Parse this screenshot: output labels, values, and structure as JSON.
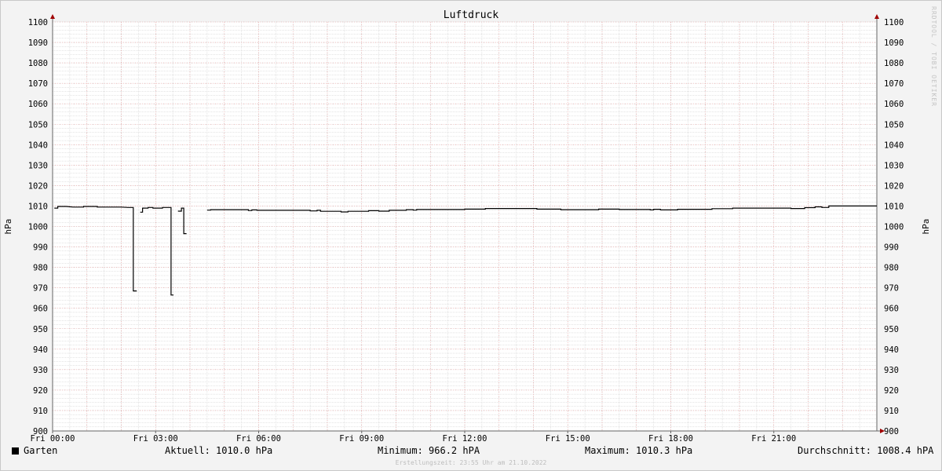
{
  "watermark": "RRDTOOL / TOBI OETIKER",
  "legend": {
    "series_label": "Garten",
    "current": "Aktuell: 1010.0 hPa",
    "minimum": "Minimum: 966.2 hPA",
    "maximum": "Maximum: 1010.3 hPa",
    "average": "Durchschnitt: 1008.4 hPA"
  },
  "footer": "Erstellungszeit: 23:55 Uhr am 21.10.2022",
  "colors": {
    "line": "#000000",
    "major_grid": "#f0a0a0",
    "minor_grid": "#c8c8c8",
    "background": "#ffffff",
    "canvas": "#f3f3f3"
  },
  "chart_data": {
    "type": "line",
    "title": "Luftdruck",
    "ylabel": "hPa",
    "ylabel_right": "hPa",
    "ylim": [
      900,
      1100
    ],
    "xlim": [
      0,
      24
    ],
    "yticks": [
      900,
      910,
      920,
      930,
      940,
      950,
      960,
      970,
      980,
      990,
      1000,
      1010,
      1020,
      1030,
      1040,
      1050,
      1060,
      1070,
      1080,
      1090,
      1100
    ],
    "xticks": [
      {
        "t": 0,
        "label": "Fri 00:00"
      },
      {
        "t": 3,
        "label": "Fri 03:00"
      },
      {
        "t": 6,
        "label": "Fri 06:00"
      },
      {
        "t": 9,
        "label": "Fri 09:00"
      },
      {
        "t": 12,
        "label": "Fri 12:00"
      },
      {
        "t": 15,
        "label": "Fri 15:00"
      },
      {
        "t": 18,
        "label": "Fri 18:00"
      },
      {
        "t": 21,
        "label": "Fri 21:00"
      }
    ],
    "grid": true,
    "legend": "bottom",
    "series": [
      {
        "name": "Garten",
        "segments": [
          [
            [
              0.05,
              1009.0
            ],
            [
              0.15,
              1009.0
            ],
            [
              0.15,
              1009.8
            ],
            [
              0.4,
              1009.8
            ],
            [
              0.6,
              1009.5
            ],
            [
              0.9,
              1009.5
            ],
            [
              0.9,
              1009.8
            ],
            [
              1.3,
              1009.8
            ],
            [
              1.3,
              1009.5
            ],
            [
              2.0,
              1009.5
            ],
            [
              2.2,
              1009.3
            ],
            [
              2.35,
              1009.3
            ],
            [
              2.35,
              968.5
            ],
            [
              2.45,
              968.5
            ]
          ],
          [
            [
              2.55,
              1007.0
            ],
            [
              2.62,
              1007.0
            ],
            [
              2.62,
              1009.0
            ],
            [
              2.78,
              1009.0
            ],
            [
              2.78,
              1009.3
            ],
            [
              2.92,
              1009.3
            ],
            [
              2.92,
              1009.0
            ],
            [
              3.2,
              1009.0
            ],
            [
              3.2,
              1009.3
            ],
            [
              3.45,
              1009.3
            ],
            [
              3.45,
              966.5
            ],
            [
              3.52,
              966.5
            ]
          ],
          [
            [
              3.65,
              1007.5
            ],
            [
              3.75,
              1007.5
            ],
            [
              3.75,
              1009.0
            ],
            [
              3.82,
              1009.0
            ],
            [
              3.82,
              996.5
            ],
            [
              3.9,
              996.5
            ]
          ],
          [
            [
              4.5,
              1008.0
            ],
            [
              4.6,
              1008.0
            ],
            [
              4.6,
              1008.2
            ],
            [
              5.7,
              1008.2
            ],
            [
              5.7,
              1007.8
            ],
            [
              5.8,
              1007.8
            ],
            [
              5.8,
              1008.1
            ],
            [
              5.95,
              1008.1
            ],
            [
              5.95,
              1007.9
            ],
            [
              7.5,
              1007.9
            ],
            [
              7.5,
              1007.6
            ],
            [
              7.7,
              1007.6
            ],
            [
              7.7,
              1007.9
            ],
            [
              7.8,
              1007.9
            ],
            [
              7.8,
              1007.4
            ],
            [
              8.4,
              1007.4
            ],
            [
              8.4,
              1007.1
            ],
            [
              8.6,
              1007.1
            ],
            [
              8.6,
              1007.4
            ],
            [
              9.2,
              1007.4
            ],
            [
              9.2,
              1007.7
            ],
            [
              9.5,
              1007.7
            ],
            [
              9.5,
              1007.5
            ],
            [
              9.8,
              1007.5
            ],
            [
              9.8,
              1007.9
            ],
            [
              10.3,
              1007.9
            ],
            [
              10.3,
              1008.2
            ],
            [
              10.5,
              1008.2
            ],
            [
              10.5,
              1008.0
            ],
            [
              10.6,
              1008.0
            ],
            [
              10.6,
              1008.3
            ],
            [
              12.0,
              1008.3
            ],
            [
              12.0,
              1008.5
            ],
            [
              12.6,
              1008.5
            ],
            [
              12.6,
              1008.8
            ],
            [
              14.1,
              1008.8
            ],
            [
              14.1,
              1008.5
            ],
            [
              14.8,
              1008.5
            ],
            [
              14.8,
              1008.2
            ],
            [
              15.9,
              1008.2
            ],
            [
              15.9,
              1008.5
            ],
            [
              16.5,
              1008.5
            ],
            [
              16.5,
              1008.3
            ],
            [
              17.4,
              1008.3
            ],
            [
              17.4,
              1008.1
            ],
            [
              17.5,
              1008.1
            ],
            [
              17.5,
              1008.4
            ],
            [
              17.7,
              1008.4
            ],
            [
              17.7,
              1008.1
            ],
            [
              18.2,
              1008.1
            ],
            [
              18.2,
              1008.4
            ],
            [
              19.2,
              1008.4
            ],
            [
              19.2,
              1008.7
            ],
            [
              19.8,
              1008.7
            ],
            [
              19.8,
              1009.0
            ],
            [
              21.5,
              1009.0
            ],
            [
              21.5,
              1008.8
            ],
            [
              21.9,
              1008.8
            ],
            [
              21.9,
              1009.2
            ],
            [
              22.2,
              1009.2
            ],
            [
              22.2,
              1009.6
            ],
            [
              22.4,
              1009.6
            ],
            [
              22.4,
              1009.3
            ],
            [
              22.6,
              1009.3
            ],
            [
              22.6,
              1010.0
            ],
            [
              24.0,
              1010.0
            ]
          ]
        ]
      }
    ]
  }
}
